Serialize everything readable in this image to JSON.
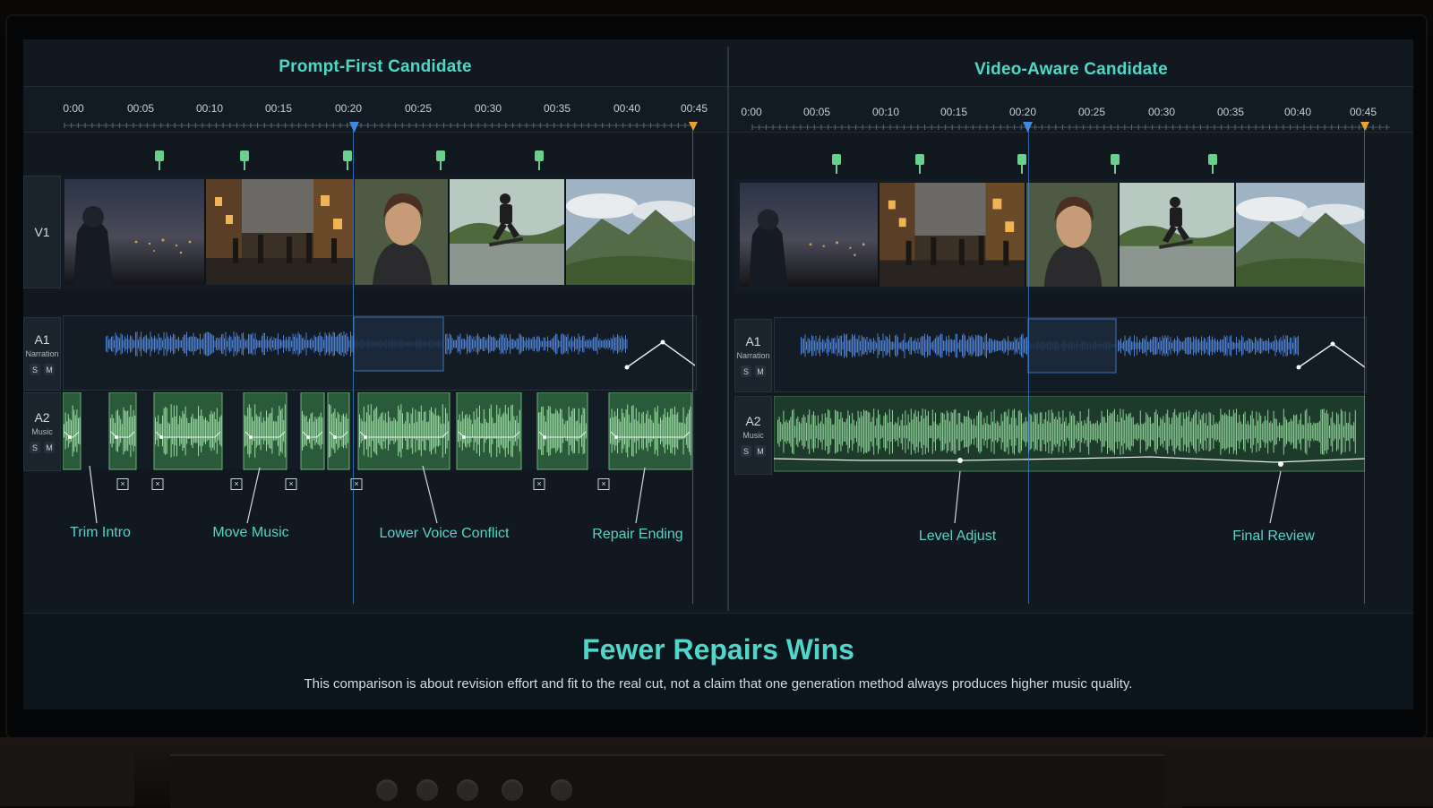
{
  "left_panel": {
    "title": "Prompt-First Candidate",
    "ruler_labels": [
      "0:00",
      "00:05",
      "00:10",
      "00:15",
      "00:20",
      "00:25",
      "00:30",
      "00:35",
      "00:40",
      "00:45"
    ],
    "tracks": {
      "v1": {
        "id": "V1"
      },
      "a1": {
        "id": "A1",
        "sub": "Narration",
        "solo": "S",
        "mute": "M"
      },
      "a2": {
        "id": "A2",
        "sub": "Music",
        "solo": "S",
        "mute": "M"
      }
    },
    "callouts": [
      "Trim Intro",
      "Move Music",
      "Lower Voice Conflict",
      "Repair Ending"
    ],
    "x_glyph": "×"
  },
  "right_panel": {
    "title": "Video-Aware Candidate",
    "ruler_labels": [
      "0:00",
      "00:05",
      "00:10",
      "00:15",
      "00:20",
      "00:25",
      "00:30",
      "00:35",
      "00:40",
      "00:45"
    ],
    "tracks": {
      "v1": {
        "id": "V1"
      },
      "a1": {
        "id": "A1",
        "sub": "Narration",
        "solo": "S",
        "mute": "M"
      },
      "a2": {
        "id": "A2",
        "sub": "Music",
        "solo": "S",
        "mute": "M"
      }
    },
    "callouts": [
      "Level Adjust",
      "Final Review"
    ]
  },
  "footer": {
    "title": "Fewer Repairs Wins",
    "subtitle": "This comparison is about revision effort and fit to the real cut, not a claim that one generation method always produces higher music quality."
  },
  "colors": {
    "accent": "#4fd6c8",
    "narration_wave": "#4f7fd1",
    "music_wave": "#7fbf85",
    "playhead": "#3d8be0",
    "end_marker": "#f0a12a",
    "marker": "#6bcf8e"
  },
  "icons": [
    "playhead-icon",
    "end-marker-icon",
    "beat-marker-icon",
    "remove-cut-icon",
    "keyframe-icon"
  ]
}
